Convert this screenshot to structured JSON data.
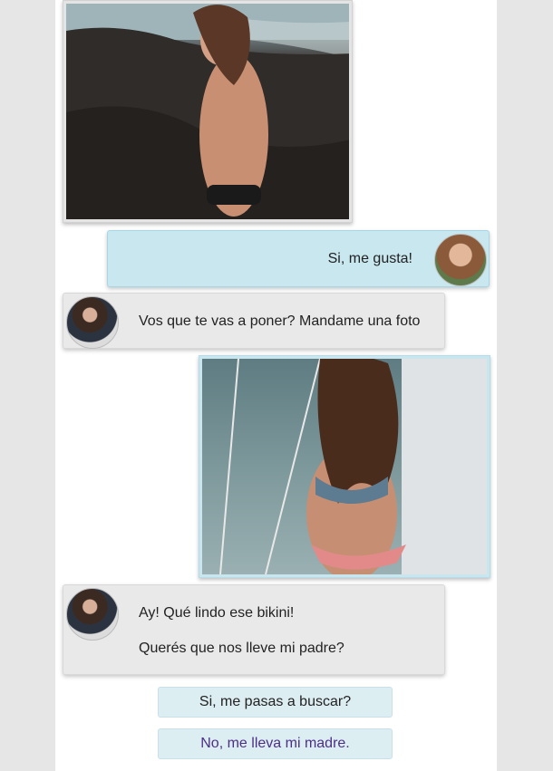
{
  "messages": {
    "m1": {
      "text": "Si, me gusta!"
    },
    "m2": {
      "text": "Vos que te vas a poner? Mandame una foto"
    },
    "m3": {
      "line1": "Ay! Qué lindo ese bikini!",
      "line2": "Querés que nos lleve mi padre?"
    }
  },
  "choices": [
    {
      "label": "Si, me pasas a buscar?"
    },
    {
      "label": "No, me lleva mi madre."
    }
  ],
  "colors": {
    "sent_bubble": "#c8e7ef",
    "received_bubble": "#e9e9e9",
    "choice_bg": "#ddeef3",
    "choice2_text": "#4b2f86"
  }
}
